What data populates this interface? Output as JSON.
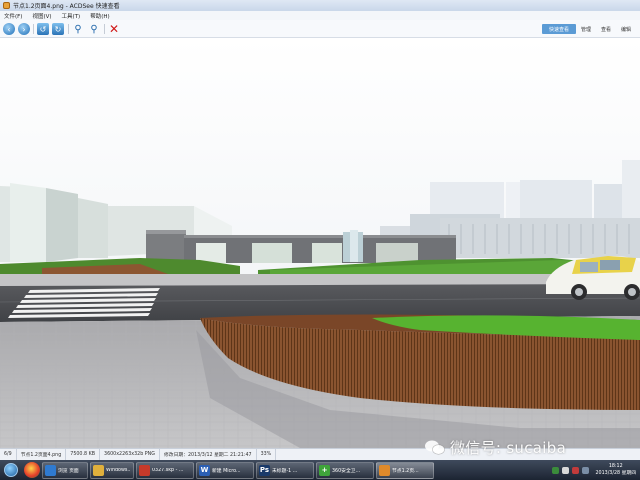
{
  "window": {
    "title": "节点1.2页面4.png - ACDSee 快速查看"
  },
  "menu": [
    "文件(F)",
    "视图(V)",
    "工具(T)",
    "帮助(H)"
  ],
  "toolbar": {
    "modes": [
      "快速查看",
      "管理",
      "查看",
      "编辑"
    ],
    "active_mode": "快速查看"
  },
  "status": {
    "index": "6/9",
    "filename": "节点1.2页面4.png",
    "filesize": "7500.8 KB",
    "dimensions": "3600x2263x32b PNG",
    "modified": "修改日期：2013/3/12 星期二 21:21:47",
    "zoom": "33%"
  },
  "watermark": {
    "text": "微信号: sucaiba"
  },
  "taskbar": {
    "tasks": [
      {
        "label": "浏览 页面",
        "icon": "browser-icon",
        "color": "#2f7ad0"
      },
      {
        "label": "Windows...",
        "icon": "folder-icon",
        "color": "#e0b03c"
      },
      {
        "label": "0327.skp - ...",
        "icon": "sketchup-icon",
        "color": "#c73a2a"
      },
      {
        "label": "新建 Micro...",
        "icon": "word-icon",
        "color": "#2b5fb4"
      },
      {
        "label": "未标题-1 ...",
        "icon": "photoshop-icon",
        "color": "#1a3a6a"
      },
      {
        "label": "360安全卫...",
        "icon": "security-icon",
        "color": "#3fa43a"
      },
      {
        "label": "节点1.2页...",
        "icon": "acdsee-icon",
        "color": "#e08a2a"
      }
    ],
    "clock_time": "18:12",
    "clock_date": "2013/3/28 星期四"
  },
  "colors": {
    "accent": "#5b9bd5",
    "title_bar": "#c9d7ea",
    "taskbar": "#1c2432",
    "delete": "#d01818"
  }
}
